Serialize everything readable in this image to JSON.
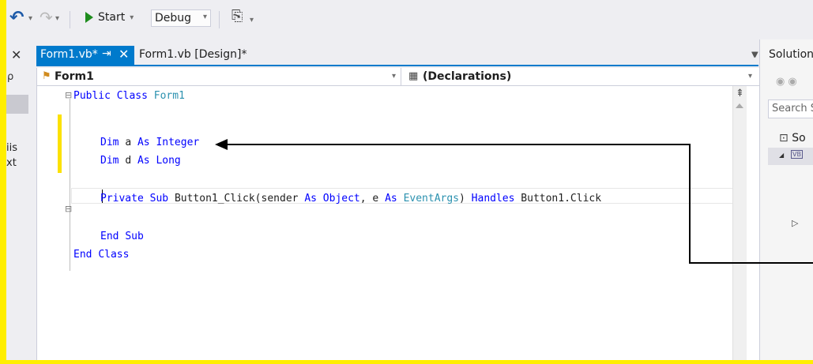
{
  "toolbar": {
    "start_label": "Start",
    "config_value": "Debug"
  },
  "left_panel": {
    "close_glyph": "✕",
    "search_glyph": "ρ",
    "text_line1": "iis",
    "text_line2": "xt"
  },
  "tabs": [
    {
      "label": "Form1.vb*",
      "active": true
    },
    {
      "label": "Form1.vb [Design]*",
      "active": false
    }
  ],
  "navbar": {
    "class_dropdown": "Form1",
    "member_dropdown": "(Declarations)"
  },
  "code": {
    "line1": {
      "kw1": "Public",
      "kw2": "Class",
      "name": "Form1"
    },
    "line2": {
      "kw1": "Dim",
      "var": "a",
      "kw2": "As",
      "type": "Integer"
    },
    "line3": {
      "kw1": "Dim",
      "var": "d",
      "kw2": "As",
      "type": "Long"
    },
    "line4": {
      "kw1": "Private",
      "kw2": "Sub",
      "sig1": "Button1_Click(sender",
      "as1": "As",
      "obj": "Object",
      "sig2": ", e",
      "as2": "As",
      "evargs": "EventArgs",
      "sig3": ")",
      "handles": "Handles",
      "target": "Button1.Click"
    },
    "line5": {
      "kw1": "End",
      "kw2": "Sub"
    },
    "line6": {
      "kw1": "End",
      "kw2": "Class"
    }
  },
  "solution_explorer": {
    "title": "Solution",
    "search_placeholder": "Search S",
    "solution_item": "So",
    "project_badge": "VB"
  },
  "colors": {
    "accent": "#007acc",
    "highlight_yellow": "#ffee00",
    "keyword": "#0000ff",
    "type": "#2b91af"
  }
}
